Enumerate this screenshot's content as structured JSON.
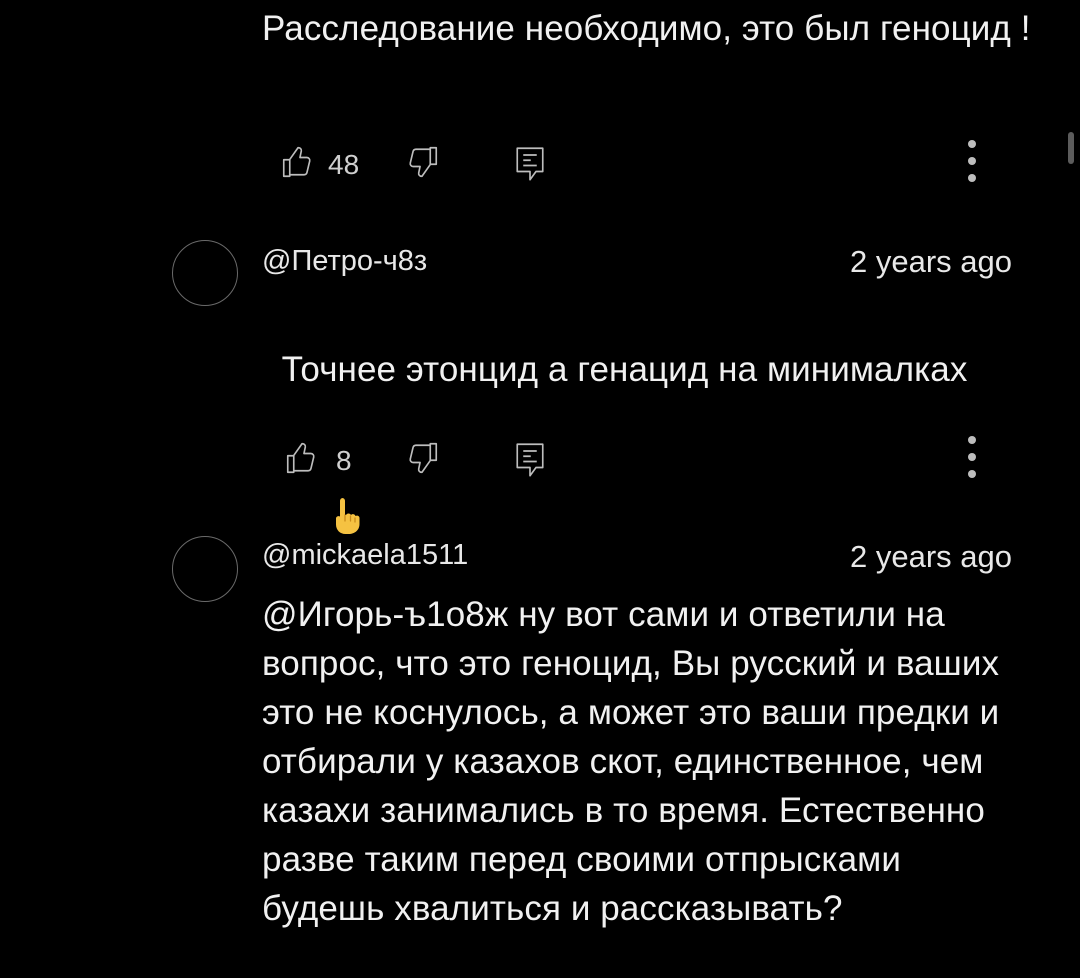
{
  "comments": [
    {
      "text": "Расследование необходимо, это был геноцид !",
      "likes": "48",
      "like_icon": "thumb-up-icon",
      "dislike_icon": "thumb-down-icon",
      "reply_icon": "comment-reply-icon",
      "more_icon": "more-vert-icon"
    },
    {
      "author": "@Петро-ч8з",
      "timestamp": "2 years ago",
      "text": "Точнее этонцид а генацид на минималках",
      "emoji": "☝",
      "likes": "8"
    },
    {
      "author": "@mickaela1511",
      "timestamp": "2 years ago",
      "text": "@Игорь-ъ1о8ж ну вот сами и ответили на вопрос, что это геноцид, Вы русский и ваших это не коснулось, а может это ваши предки и отбирали у казахов скот, единственное, чем казахи занимались в то время. Естественно разве таким перед своими отпрысками будешь хвалиться и рассказывать?"
    }
  ],
  "colors": {
    "background": "#000000",
    "text": "#f1f1f1",
    "icon": "#bdbdbd",
    "emoji": "#f5c242"
  }
}
